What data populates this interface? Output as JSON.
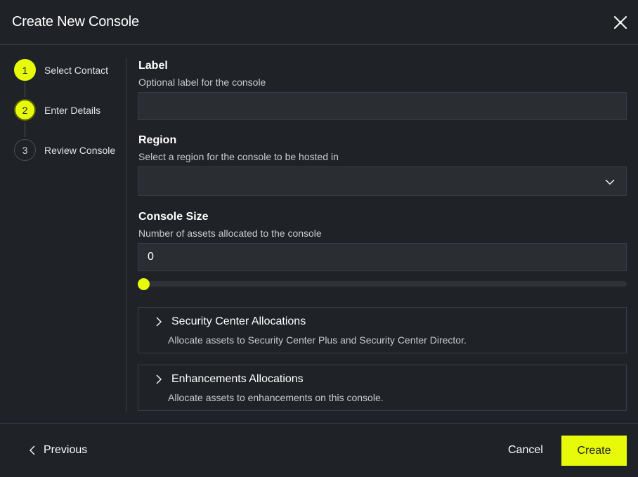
{
  "dialog": {
    "title": "Create New Console"
  },
  "steps": [
    {
      "number": "1",
      "label": "Select Contact",
      "state": "complete"
    },
    {
      "number": "2",
      "label": "Enter Details",
      "state": "current"
    },
    {
      "number": "3",
      "label": "Review Console",
      "state": "pending"
    }
  ],
  "form": {
    "label": {
      "title": "Label",
      "description": "Optional label for the console",
      "value": ""
    },
    "region": {
      "title": "Region",
      "description": "Select a region for the console to be hosted in",
      "selected": ""
    },
    "console_size": {
      "title": "Console Size",
      "description": "Number of assets allocated to the console",
      "value": "0",
      "slider_value": 0
    }
  },
  "accordions": [
    {
      "title": "Security Center Allocations",
      "description": "Allocate assets to Security Center Plus and Security Center Director."
    },
    {
      "title": "Enhancements Allocations",
      "description": "Allocate assets to enhancements on this console."
    }
  ],
  "footer": {
    "previous_label": "Previous",
    "cancel_label": "Cancel",
    "create_label": "Create"
  },
  "colors": {
    "accent": "#e6fa0a",
    "background": "#1f2226",
    "input_bg": "#2a2e33",
    "border": "#3a3e44"
  },
  "icons": {
    "close": "close-icon",
    "chevron_down": "chevron-down-icon",
    "chevron_right": "chevron-right-icon",
    "chevron_left": "chevron-left-icon"
  }
}
